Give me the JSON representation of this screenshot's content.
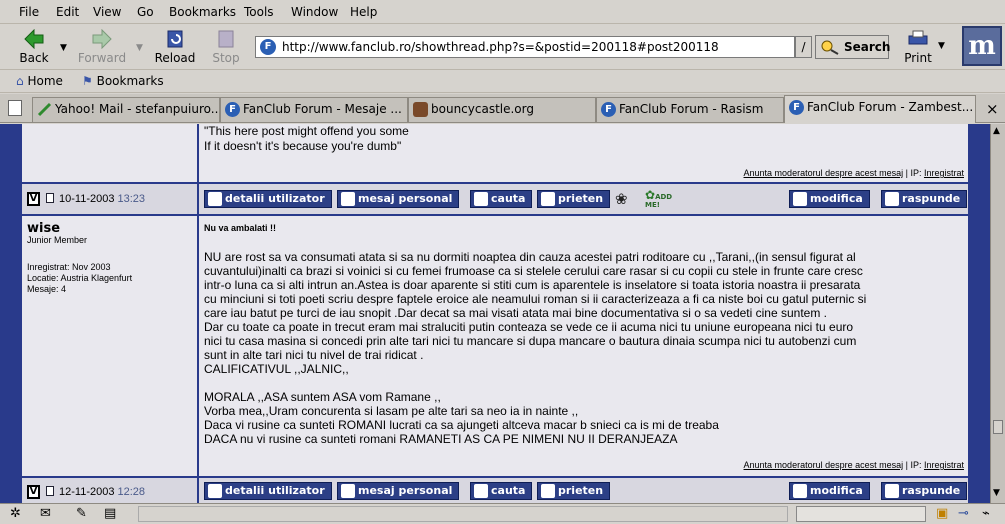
{
  "menu": [
    "File",
    "Edit",
    "View",
    "Go",
    "Bookmarks",
    "Tools",
    "Window",
    "Help"
  ],
  "toolbar": {
    "back": "Back",
    "forward": "Forward",
    "reload": "Reload",
    "stop": "Stop",
    "url": "http://www.fanclub.ro/showthread.php?s=&postid=200118#post200118",
    "url_slash": "/",
    "search": "Search",
    "print": "Print"
  },
  "personal": {
    "home": "Home",
    "bookmarks": "Bookmarks"
  },
  "tabs": [
    {
      "label": "Yahoo! Mail - stefanpuiuro...",
      "icon": "yahoo-pen-icon"
    },
    {
      "label": "FanClub Forum - Mesaje ...",
      "icon": "fanclub-icon"
    },
    {
      "label": "bouncycastle.org",
      "icon": "bouncycastle-icon"
    },
    {
      "label": "FanClub Forum - Rasism",
      "icon": "fanclub-icon"
    },
    {
      "label": "FanClub Forum - Zambest...",
      "icon": "fanclub-icon"
    }
  ],
  "tab_close": "×",
  "post_prev": {
    "line1": "\"This here post might offend you some",
    "line2": "If it doesn't it's because you're dumb\"",
    "report": "Anunta moderatorul despre acest mesaj",
    "ip_sep": " | IP: ",
    "ip": "Inregistrat"
  },
  "bar1": {
    "date": "10-11-2003",
    "time": "13:23"
  },
  "bar_buttons": {
    "details": "detalii utilizator",
    "pm": "mesaj personal",
    "search": "cauta",
    "friends": "prieten",
    "edit": "modifica",
    "reply": "raspunde",
    "add_me": "ADD ME!"
  },
  "post": {
    "author": "wise",
    "rank": "Junior Member",
    "registered": "Inregistrat: Nov 2003",
    "location": "Locatie: Austria Klagenfurt",
    "posts": "Mesaje: 4",
    "title": "Nu va ambalati !!",
    "lines": [
      "NU are rost sa va consumati atata si sa nu dormiti noaptea din cauza acestei patri roditoare cu ,,Tarani,,(in sensul figurat al",
      "cuvantului)inalti ca brazi si voinici si cu femei frumoase ca si stelele cerului care rasar si cu copii cu stele in frunte care cresc",
      "intr-o luna ca si alti intrun an.Astea is doar aparente si stiti cum is aparentele is inselatore si toata istoria noastra ii presarata",
      "cu minciuni si toti poeti scriu despre faptele eroice ale neamului roman si ii caracterizeaza a fi ca niste boi cu gatul puternic si",
      "care iau batut pe turci de iau snopit .Dar decat sa mai visati atata mai bine documentativa si o sa vedeti cine suntem .",
      "Dar cu toate ca poate in trecut eram mai straluciti putin conteaza se vede ce ii acuma nici tu uniune europeana nici tu euro",
      "nici tu casa masina si concedi prin alte tari nici tu mancare si dupa mancare o bautura dinaia scumpa nici tu autobenzi cum",
      "sunt in alte tari nici tu nivel de trai ridicat .",
      "CALIFICATIVUL ,,JALNIC,,",
      "",
      "MORALA ,,ASA suntem ASA vom Ramane ,,",
      "Vorba mea,,Uram concurenta si lasam pe alte tari sa neo ia in nainte ,,",
      "Daca vi rusine ca sunteti ROMANI lucrati ca sa ajungeti altceva macar b  snieci ca is mi de treaba",
      "DACA nu vi rusine ca sunteti romani RAMANETI AS CA PE NIMENI NU II DERANJEAZA"
    ],
    "report": "Anunta moderatorul despre acest mesaj",
    "ip_sep": " | IP: ",
    "ip": "Inregistrat"
  },
  "bar2": {
    "date": "12-11-2003",
    "time": "12:28"
  }
}
